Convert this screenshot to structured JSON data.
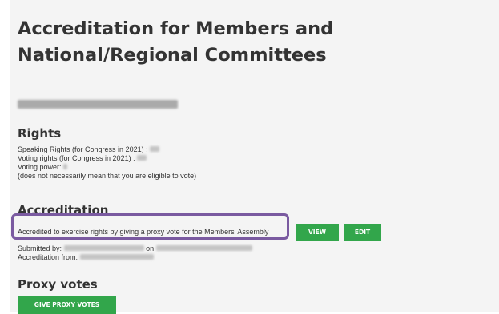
{
  "page": {
    "title": "Accreditation for Members and National/Regional Committees"
  },
  "rights": {
    "heading": "Rights",
    "speaking_label": "Speaking Rights (for Congress in 2021) :",
    "voting_label": "Voting rights (for Congress in 2021) :",
    "power_label": "Voting power:",
    "note": "(does not necessarily mean that you are eligible to vote)"
  },
  "accreditation": {
    "heading": "Accreditation",
    "status_text": "Accredited to exercise rights by giving a proxy vote for the Members' Assembly",
    "submitted_label": "Submitted by:",
    "on_label": "on",
    "from_label": "Accreditation from:",
    "view_label": "VIEW",
    "edit_label": "EDIT"
  },
  "proxy": {
    "heading": "Proxy votes",
    "give_label": "GIVE PROXY VOTES"
  },
  "colors": {
    "button_green": "#32a64b",
    "highlight_purple": "#7a5aa0",
    "panel_bg": "#f4f4f4"
  }
}
